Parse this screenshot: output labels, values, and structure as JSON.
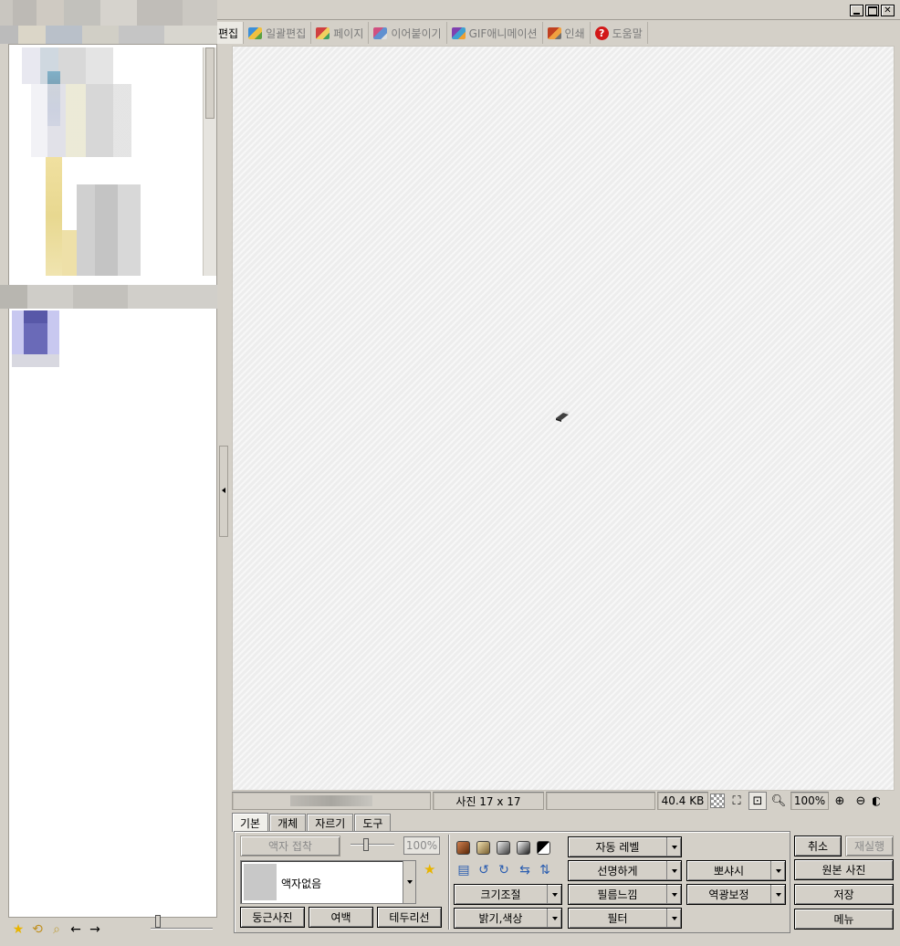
{
  "window": {
    "minimize_icon": "minimize-icon",
    "maximize_icon": "maximize-icon",
    "close_label": "✕"
  },
  "menu": {
    "items": [
      {
        "label": "편집",
        "icon": "none",
        "active": true
      },
      {
        "label": "일괄편집",
        "icon": "batch-edit-icon"
      },
      {
        "label": "페이지",
        "icon": "page-icon"
      },
      {
        "label": "이어붙이기",
        "icon": "merge-icon"
      },
      {
        "label": "GIF애니메이션",
        "icon": "gif-animation-icon"
      },
      {
        "label": "인쇄",
        "icon": "print-icon"
      },
      {
        "label": "도움말",
        "icon": "help-icon",
        "help_glyph": "?"
      }
    ]
  },
  "status": {
    "photo_size": "사진 17 x 17",
    "file_size": "40.4 KB",
    "zoom": "100%"
  },
  "tabs": [
    "기본",
    "개체",
    "자르기",
    "도구"
  ],
  "basic": {
    "frame_apply": "액자 접착",
    "opacity": "100%",
    "frame_selected": "액자없음",
    "round_photo": "둥근사진",
    "margin": "여백",
    "border": "테두리선",
    "auto_level": "자동 레벨",
    "sharpen": "선명하게",
    "film_feel": "필름느낌",
    "filter": "필터",
    "resize": "크기조절",
    "brightness_color": "밝기,색상",
    "soft_focus": "뽀샤시",
    "backlight": "역광보정",
    "cancel": "취소",
    "redo": "재실행",
    "original_photo": "원본 사진",
    "save": "저장",
    "menu": "메뉴"
  },
  "colors": {
    "chrome": "#d4d0c8",
    "canvas": "#ededed",
    "swatches": [
      "#8b4513",
      "#b8a070",
      "#808080",
      "#505050",
      "#000000"
    ]
  }
}
